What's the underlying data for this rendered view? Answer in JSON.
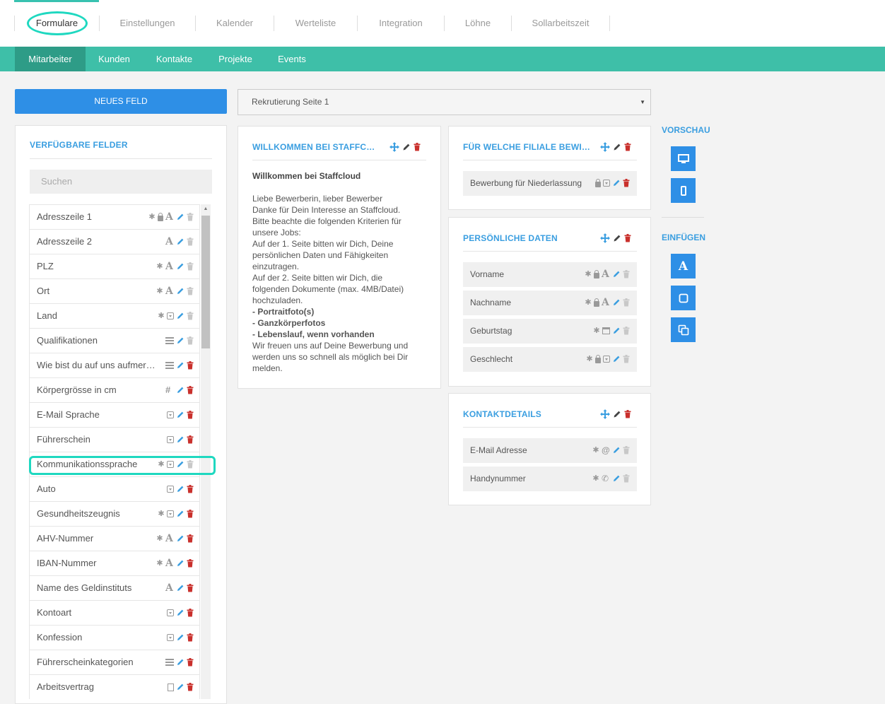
{
  "top_tabs": [
    "Formulare",
    "Einstellungen",
    "Kalender",
    "Werteliste",
    "Integration",
    "Löhne",
    "Sollarbeitszeit"
  ],
  "sub_tabs": [
    "Mitarbeiter",
    "Kunden",
    "Kontakte",
    "Projekte",
    "Events"
  ],
  "new_field_button": "NEUES FELD",
  "page_select": {
    "value": "Rekrutierung Seite 1"
  },
  "available_fields": {
    "title": "VERFÜGBARE FELDER",
    "search_placeholder": "Suchen",
    "items": [
      {
        "label": "Adresszeile 1",
        "icons": [
          "asterisk",
          "lock",
          "text"
        ],
        "deletable": false
      },
      {
        "label": "Adresszeile 2",
        "icons": [
          "text"
        ],
        "deletable": false
      },
      {
        "label": "PLZ",
        "icons": [
          "asterisk",
          "text"
        ],
        "deletable": false
      },
      {
        "label": "Ort",
        "icons": [
          "asterisk",
          "text"
        ],
        "deletable": false
      },
      {
        "label": "Land",
        "icons": [
          "asterisk",
          "dropdown"
        ],
        "deletable": false
      },
      {
        "label": "Qualifikationen",
        "icons": [
          "list"
        ],
        "deletable": false
      },
      {
        "label": "Wie bist du auf uns aufmerksam geworden",
        "icons": [
          "list"
        ],
        "deletable": true
      },
      {
        "label": "Körpergrösse in cm",
        "icons": [
          "hash"
        ],
        "deletable": true
      },
      {
        "label": "E-Mail Sprache",
        "icons": [
          "dropdown"
        ],
        "deletable": true
      },
      {
        "label": "Führerschein",
        "icons": [
          "dropdown"
        ],
        "deletable": true
      },
      {
        "label": "Kommunikationssprache",
        "icons": [
          "asterisk",
          "dropdown"
        ],
        "deletable": false
      },
      {
        "label": "Auto",
        "icons": [
          "dropdown"
        ],
        "deletable": true
      },
      {
        "label": "Gesundheitszeugnis",
        "icons": [
          "asterisk",
          "dropdown"
        ],
        "deletable": true
      },
      {
        "label": "AHV-Nummer",
        "icons": [
          "asterisk",
          "text"
        ],
        "deletable": true
      },
      {
        "label": "IBAN-Nummer",
        "icons": [
          "asterisk",
          "text"
        ],
        "deletable": true
      },
      {
        "label": "Name des Geldinstituts",
        "icons": [
          "text"
        ],
        "deletable": true
      },
      {
        "label": "Kontoart",
        "icons": [
          "dropdown"
        ],
        "deletable": true
      },
      {
        "label": "Konfession",
        "icons": [
          "dropdown"
        ],
        "deletable": true
      },
      {
        "label": "Führerscheinkategorien",
        "icons": [
          "list"
        ],
        "deletable": true
      },
      {
        "label": "Arbeitsvertrag",
        "icons": [
          "document"
        ],
        "deletable": true
      }
    ]
  },
  "welcome_card": {
    "title": "WILLKOMMEN BEI STAFFCLOUD",
    "text_title": "Willkommen bei Staffcloud",
    "lines": [
      "Liebe Bewerberin, lieber Bewerber",
      "Danke für Dein Interesse an Staffcloud.",
      "Bitte beachte die folgenden Kriterien für",
      "unsere Jobs:",
      "Auf der 1. Seite bitten wir Dich, Deine",
      "persönlichen Daten und Fähigkeiten",
      "einzutragen.",
      "Auf der 2. Seite bitten wir Dich, die",
      "folgenden Dokumente (max. 4MB/Datei)",
      "hochzuladen."
    ],
    "bold_lines": [
      "- Portraitfoto(s)",
      "- Ganzkörperfotos",
      "- Lebenslauf, wenn vorhanden"
    ],
    "closing_lines": [
      "Wir freuen uns auf Deine Bewerbung und",
      "werden uns so schnell als möglich bei Dir",
      "melden."
    ]
  },
  "branch_card": {
    "title": "FÜR WELCHE FILIALE BEWIRBST DU DICH",
    "fields": [
      {
        "label": "Bewerbung für Niederlassung",
        "icons": [
          "lock",
          "dropdown"
        ],
        "deletable": true
      }
    ]
  },
  "personal_card": {
    "title": "PERSÖNLICHE DATEN",
    "fields": [
      {
        "label": "Vorname",
        "icons": [
          "asterisk",
          "lock",
          "text"
        ],
        "deletable": false
      },
      {
        "label": "Nachname",
        "icons": [
          "asterisk",
          "lock",
          "text"
        ],
        "deletable": false
      },
      {
        "label": "Geburtstag",
        "icons": [
          "asterisk",
          "calendar"
        ],
        "deletable": false
      },
      {
        "label": "Geschlecht",
        "icons": [
          "asterisk",
          "lock",
          "dropdown"
        ],
        "deletable": false
      }
    ]
  },
  "contact_card": {
    "title": "KONTAKTDETAILS",
    "fields": [
      {
        "label": "E-Mail Adresse",
        "icons": [
          "asterisk",
          "at"
        ],
        "deletable": false
      },
      {
        "label": "Handynummer",
        "icons": [
          "asterisk",
          "phone"
        ],
        "deletable": false
      }
    ]
  },
  "sidebar": {
    "preview_title": "VORSCHAU",
    "insert_title": "EINFÜGEN"
  },
  "colors": {
    "accent_teal": "#3ebfa8",
    "primary_blue": "#2e8fe6",
    "title_blue": "#3a9ee0",
    "delete_red": "#c9302c"
  }
}
